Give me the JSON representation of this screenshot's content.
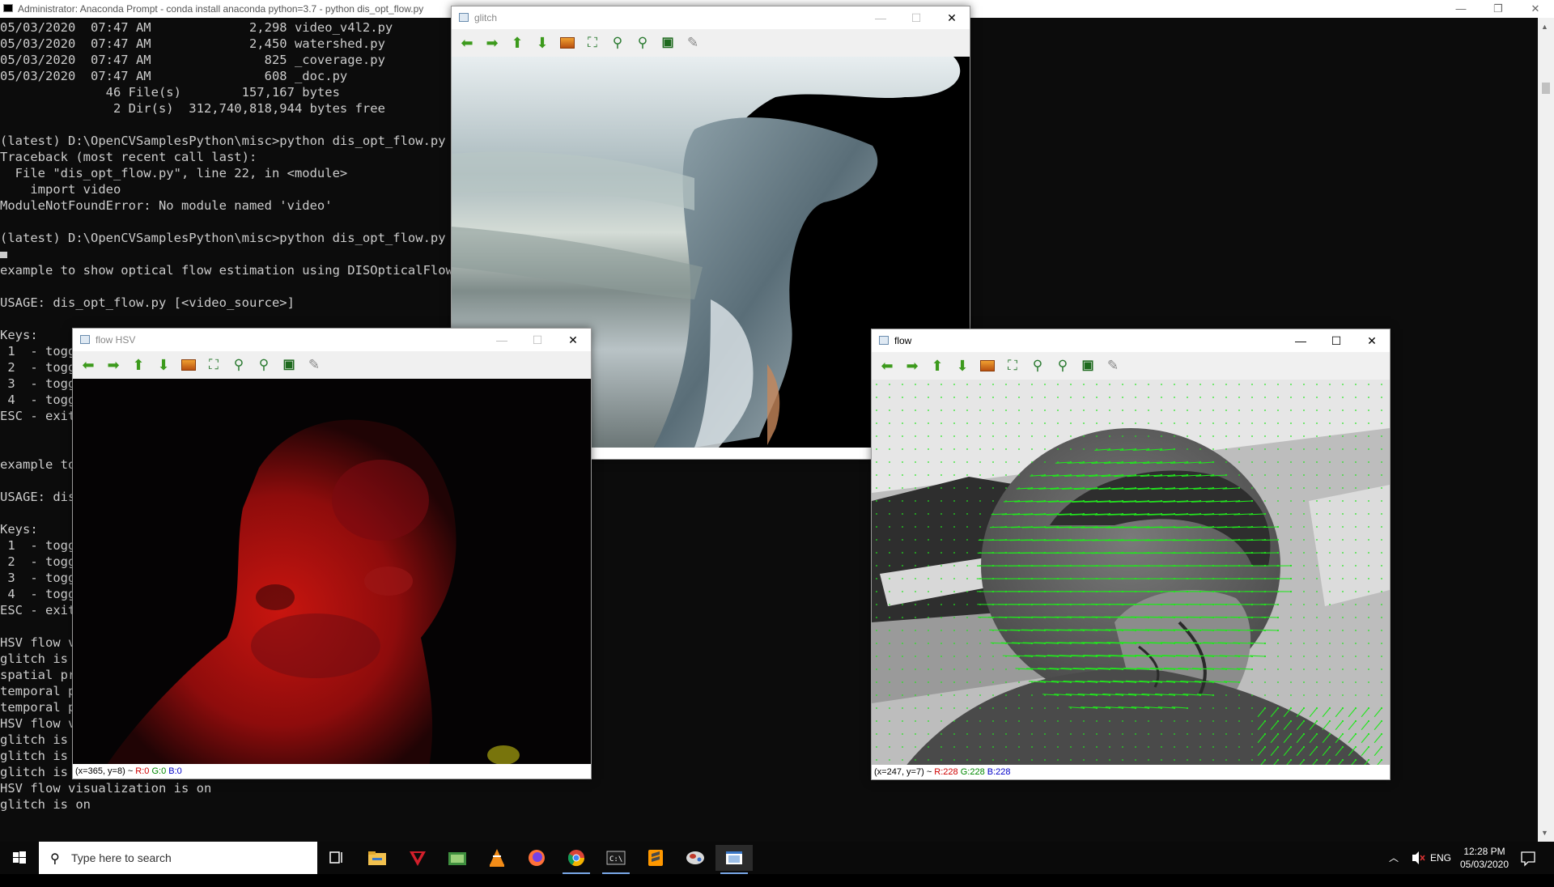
{
  "console": {
    "title": "Administrator: Anaconda Prompt - conda  install anaconda python=3.7 - python  dis_opt_flow.py",
    "controls": {
      "minimize": "—",
      "maximize": "❐",
      "close": "✕"
    },
    "lines": [
      "05/03/2020  07:47 AM             2,298 video_v4l2.py",
      "05/03/2020  07:47 AM             2,450 watershed.py",
      "05/03/2020  07:47 AM               825 _coverage.py",
      "05/03/2020  07:47 AM               608 _doc.py",
      "              46 File(s)        157,167 bytes",
      "               2 Dir(s)  312,740,818,944 bytes free",
      "",
      "(latest) D:\\OpenCVSamplesPython\\misc>python dis_opt_flow.py",
      "Traceback (most recent call last):",
      "  File \"dis_opt_flow.py\", line 22, in <module>",
      "    import video",
      "ModuleNotFoundError: No module named 'video'",
      "",
      "(latest) D:\\OpenCVSamplesPython\\misc>python dis_opt_flow.py",
      "",
      "example to show optical flow estimation using DISOpticalFlow",
      "",
      "USAGE: dis_opt_flow.py [<video_source>]",
      "",
      "Keys:",
      " 1  - togg",
      " 2  - togg",
      " 3  - togg",
      " 4  - togg",
      "ESC - exit",
      "",
      "",
      "example to",
      "",
      "USAGE: dis",
      "",
      "Keys:",
      " 1  - togg",
      " 2  - togg",
      " 3  - togg",
      " 4  - togg",
      "ESC - exit",
      "",
      "HSV flow v",
      "glitch is ",
      "spatial pr",
      "temporal p",
      "temporal p",
      "HSV flow v",
      "glitch is ",
      "glitch is ",
      "glitch is ",
      "HSV flow visualization is on",
      "glitch is on"
    ]
  },
  "windows": {
    "glitch": {
      "title": "glitch"
    },
    "flow_hsv": {
      "title": "flow HSV",
      "status": {
        "coords": "(x=365, y=8) ~ ",
        "r": "R:0",
        "g": "G:0",
        "b": "B:0"
      }
    },
    "flow": {
      "title": "flow",
      "status": {
        "coords": "(x=247, y=7) ~ ",
        "r": "R:228",
        "g": "G:228",
        "b": "B:228"
      }
    }
  },
  "toolbar_icons": [
    "arrow-left-icon",
    "arrow-right-icon",
    "arrow-up-icon",
    "arrow-down-icon",
    "image-icon",
    "zoom-fit-icon",
    "zoom-in-icon",
    "zoom-out-icon",
    "save-icon",
    "brush-icon"
  ],
  "taskbar": {
    "search_placeholder": "Type here to search",
    "apps": [
      "task-view-icon",
      "file-explorer-icon",
      "app-y-icon",
      "image-viewer-icon",
      "vlc-icon",
      "firefox-icon",
      "chrome-icon",
      "terminal-icon",
      "sublime-icon",
      "vm-icon",
      "opencv-window-icon"
    ],
    "tray": {
      "language": "ENG",
      "time": "12:28 PM",
      "date": "05/03/2020"
    }
  },
  "colors": {
    "flow_vectors": "#22e61e",
    "console_text": "#cccccc",
    "taskbar": "#0a0a0a"
  }
}
